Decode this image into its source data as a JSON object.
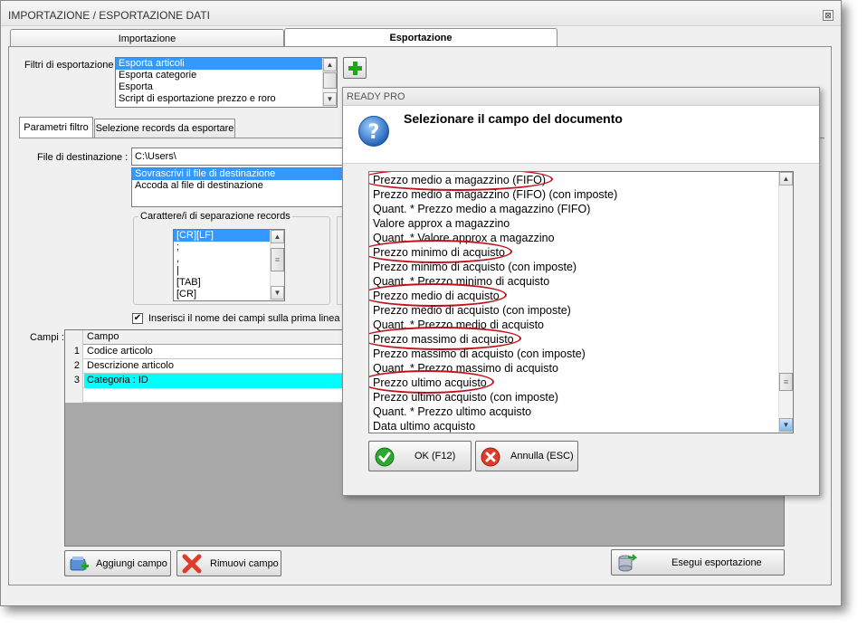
{
  "window": {
    "title": "IMPORTAZIONE / ESPORTAZIONE DATI",
    "close_glyph": "⊠"
  },
  "tabs": [
    {
      "label": "Importazione",
      "active": false
    },
    {
      "label": "Esportazione",
      "active": true
    }
  ],
  "filters": {
    "label": "Filtri di esportazione :",
    "items": [
      {
        "label": "Esporta articoli",
        "selected": true
      },
      {
        "label": "Esporta categorie",
        "selected": false
      },
      {
        "label": "Esporta",
        "selected": false
      },
      {
        "label": "Script di esportazione prezzo e roro",
        "selected": false
      }
    ]
  },
  "subtabs": [
    {
      "label": "Parametri filtro",
      "active": true
    },
    {
      "label": "Selezione records da esportare",
      "active": false
    }
  ],
  "destination": {
    "label": "File di destinazione :",
    "value": "C:\\Users\\",
    "modes": [
      {
        "label": "Sovrascrivi il file di destinazione",
        "selected": true
      },
      {
        "label": "Accoda al file di destinazione",
        "selected": false
      }
    ]
  },
  "separator": {
    "title": "Carattere/i di separazione records",
    "items": [
      {
        "label": "[CR][LF]",
        "selected": true
      },
      {
        "label": ";",
        "selected": false
      },
      {
        "label": ",",
        "selected": false
      },
      {
        "label": "|",
        "selected": false
      },
      {
        "label": "[TAB]",
        "selected": false
      },
      {
        "label": "[CR]",
        "selected": false
      }
    ]
  },
  "checkbox": {
    "label": "Inserisci il nome dei campi sulla prima linea",
    "checked": true,
    "mark": "✔"
  },
  "fields_grid": {
    "label": "Campi :",
    "column": "Campo",
    "rows": [
      {
        "num": "1",
        "value": "Codice articolo",
        "highlighted": false
      },
      {
        "num": "2",
        "value": "Descrizione articolo",
        "highlighted": false
      },
      {
        "num": "3",
        "value": "Categoria : ID",
        "highlighted": true
      }
    ],
    "highlight_color": "#00ffff"
  },
  "buttons": {
    "aggiungi": "Aggiungi campo",
    "rimuovi": "Rimuovi campo",
    "esegui": "Esegui esportazione"
  },
  "dialog": {
    "title": "READY PRO",
    "prompt": "Selezionare il campo del documento",
    "items": [
      {
        "label": "Prezzo medio a magazzino (FIFO)",
        "circled": true
      },
      {
        "label": "Prezzo medio a magazzino (FIFO) (con imposte)",
        "circled": false
      },
      {
        "label": "Quant. * Prezzo medio a magazzino (FIFO)",
        "circled": false
      },
      {
        "label": "Valore approx a magazzino",
        "circled": false
      },
      {
        "label": "Quant. * Valore approx a magazzino",
        "circled": false
      },
      {
        "label": "Prezzo minimo di acquisto",
        "circled": true
      },
      {
        "label": "Prezzo minimo di acquisto (con imposte)",
        "circled": false
      },
      {
        "label": "Quant. * Prezzo minimo di acquisto",
        "circled": false
      },
      {
        "label": "Prezzo medio di acquisto",
        "circled": true
      },
      {
        "label": "Prezzo medio di acquisto (con imposte)",
        "circled": false
      },
      {
        "label": "Quant. * Prezzo medio di acquisto",
        "circled": false
      },
      {
        "label": "Prezzo massimo di acquisto",
        "circled": true
      },
      {
        "label": "Prezzo massimo di acquisto (con imposte)",
        "circled": false
      },
      {
        "label": "Quant. * Prezzo massimo di acquisto",
        "circled": false
      },
      {
        "label": "Prezzo ultimo acquisto",
        "circled": true
      },
      {
        "label": "Prezzo ultimo acquisto (con imposte)",
        "circled": false
      },
      {
        "label": "Quant. * Prezzo ultimo acquisto",
        "circled": false
      },
      {
        "label": "Data ultimo acquisto",
        "circled": false
      }
    ],
    "ok_label": "OK (F12)",
    "cancel_label": "Annulla (ESC)",
    "oval_color": "#c0141c"
  }
}
